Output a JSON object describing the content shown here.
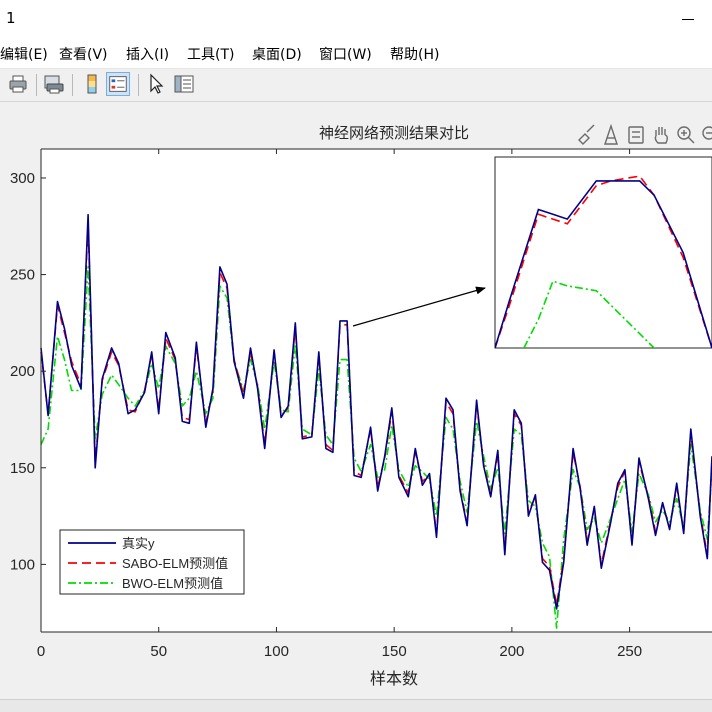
{
  "window": {
    "title": "1"
  },
  "menu": [
    {
      "label": "编辑(E)"
    },
    {
      "label": "查看(V)"
    },
    {
      "label": "插入(I)"
    },
    {
      "label": "工具(T)"
    },
    {
      "label": "桌面(D)"
    },
    {
      "label": "窗口(W)"
    },
    {
      "label": "帮助(H)"
    }
  ],
  "toolbar": {
    "icons": [
      "print-icon",
      "print-preview-icon",
      "colorbar-icon",
      "legend-icon",
      "pointer-icon",
      "property-editor-icon"
    ]
  },
  "axes_toolbar": {
    "icons": [
      "brush-icon",
      "data-tips-icon",
      "restore-view-icon",
      "pan-icon",
      "zoom-in-icon",
      "zoom-out-icon"
    ]
  },
  "colors": {
    "true": "#00008b",
    "sabo": "#ff0000",
    "bwo": "#00dd00",
    "arrow": "#000000"
  },
  "chart_data": {
    "type": "line",
    "title": "神经网络预测结果对比",
    "xlabel": "样本数",
    "ylabel": "",
    "xlim": [
      0,
      285
    ],
    "ylim": [
      65,
      315
    ],
    "xticks": [
      "0",
      "50",
      "100",
      "150",
      "200",
      "250"
    ],
    "yticks": [
      "100",
      "150",
      "200",
      "250",
      "300"
    ],
    "grid": false,
    "legend_position": "bottom-left",
    "x": [
      0,
      3,
      7,
      10,
      13,
      17,
      20,
      23,
      26,
      30,
      33,
      37,
      40,
      44,
      47,
      50,
      53,
      57,
      60,
      63,
      66,
      70,
      73,
      76,
      79,
      82,
      86,
      89,
      92,
      95,
      99,
      102,
      105,
      108,
      111,
      115,
      118,
      121,
      124,
      127,
      130,
      133,
      136,
      140,
      143,
      146,
      149,
      152,
      156,
      159,
      162,
      165,
      168,
      172,
      175,
      178,
      181,
      185,
      188,
      191,
      194,
      197,
      201,
      204,
      207,
      210,
      213,
      216,
      219,
      222,
      226,
      229,
      232,
      235,
      238,
      242,
      245,
      248,
      251,
      254,
      258,
      261,
      264,
      267,
      270,
      273,
      276,
      280,
      283,
      285
    ],
    "series": [
      {
        "name": "真实y",
        "values": [
          212,
          177,
          236,
          222,
          203,
          191,
          281,
          150,
          196,
          212,
          204,
          178,
          180,
          189,
          210,
          178,
          220,
          207,
          174,
          173,
          215,
          171,
          191,
          254,
          245,
          205,
          186,
          212,
          191,
          160,
          211,
          176,
          182,
          225,
          165,
          166,
          210,
          160,
          158,
          226,
          226,
          146,
          145,
          171,
          138,
          156,
          181,
          145,
          135,
          160,
          141,
          147,
          114,
          186,
          180,
          138,
          120,
          185,
          151,
          135,
          159,
          105,
          180,
          173,
          125,
          136,
          101,
          97,
          77,
          101,
          160,
          139,
          110,
          130,
          98,
          122,
          142,
          149,
          110,
          155,
          134,
          115,
          132,
          118,
          142,
          116,
          170,
          125,
          103,
          156
        ],
        "style": "solid"
      },
      {
        "name": "SABO-ELM预测值",
        "values": [
          210,
          178,
          234,
          220,
          205,
          193,
          276,
          153,
          195,
          210,
          203,
          180,
          179,
          190,
          209,
          180,
          217,
          206,
          176,
          175,
          213,
          173,
          190,
          251,
          243,
          206,
          188,
          210,
          192,
          162,
          210,
          177,
          181,
          223,
          166,
          167,
          208,
          162,
          159,
          224,
          224,
          148,
          146,
          170,
          140,
          155,
          179,
          146,
          137,
          158,
          143,
          146,
          116,
          184,
          178,
          139,
          121,
          183,
          152,
          136,
          157,
          107,
          178,
          172,
          127,
          135,
          103,
          99,
          79,
          103,
          158,
          140,
          112,
          129,
          100,
          123,
          140,
          148,
          111,
          153,
          135,
          117,
          131,
          119,
          140,
          117,
          168,
          126,
          105,
          154
        ],
        "style": "dashed"
      },
      {
        "name": "BWO-ELM预测值",
        "values": [
          162,
          170,
          218,
          206,
          190,
          190,
          254,
          165,
          188,
          198,
          193,
          186,
          182,
          190,
          204,
          191,
          213,
          204,
          182,
          186,
          200,
          178,
          186,
          244,
          238,
          205,
          190,
          206,
          193,
          170,
          205,
          180,
          179,
          214,
          170,
          167,
          201,
          167,
          162,
          206,
          206,
          155,
          148,
          162,
          145,
          149,
          172,
          149,
          140,
          151,
          148,
          144,
          125,
          176,
          170,
          143,
          127,
          174,
          156,
          139,
          150,
          116,
          170,
          167,
          133,
          130,
          111,
          104,
          67,
          113,
          149,
          140,
          118,
          124,
          111,
          124,
          134,
          144,
          117,
          147,
          136,
          122,
          128,
          122,
          134,
          119,
          162,
          128,
          113,
          149
        ],
        "style": "dashdot"
      }
    ],
    "inset": {
      "xlim": [
        120,
        135
      ],
      "ylim": [
        190,
        230
      ],
      "series": [
        {
          "name": "真实y",
          "x": [
            120,
            121,
            123,
            124,
            125,
            127,
            128,
            130,
            131,
            133,
            135
          ],
          "values": [
            190,
            200,
            219,
            218,
            217,
            225,
            225,
            225,
            222,
            210,
            190
          ]
        },
        {
          "name": "SABO-ELM预测值",
          "x": [
            120,
            121,
            123,
            124,
            125,
            127,
            128,
            130,
            131,
            133,
            135
          ],
          "values": [
            190,
            199,
            218,
            217,
            216,
            224,
            225,
            226,
            222,
            209,
            190
          ]
        },
        {
          "name": "BWO-ELM预测值",
          "x": [
            120,
            121,
            123,
            124,
            125,
            127,
            128,
            130,
            131,
            133,
            135
          ],
          "values": [
            178,
            184,
            196,
            204,
            203,
            202,
            199,
            193,
            190,
            188,
            182
          ]
        }
      ]
    }
  }
}
